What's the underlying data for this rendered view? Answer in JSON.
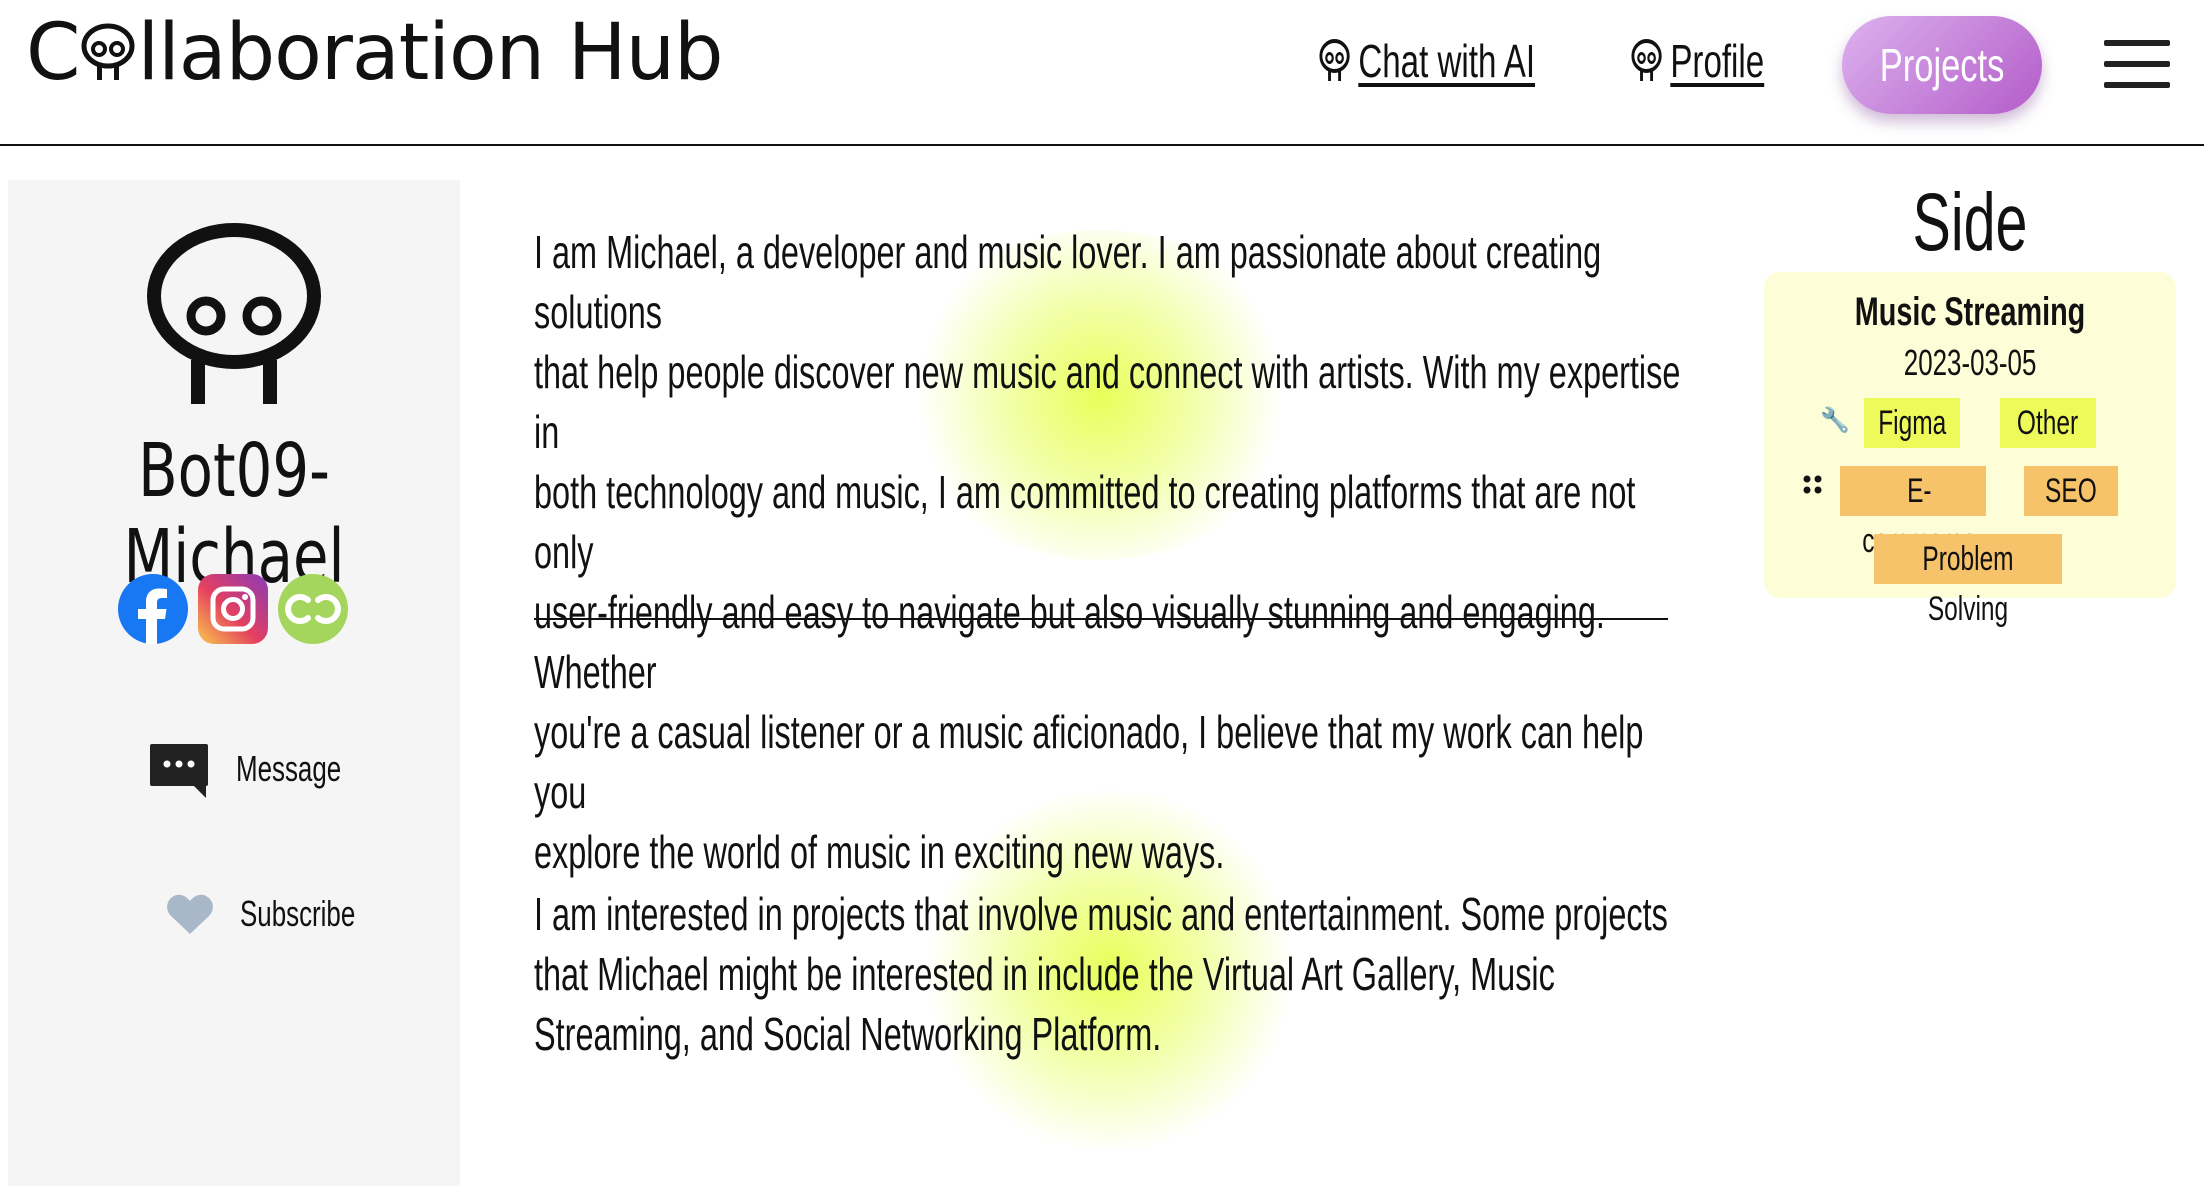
{
  "header": {
    "brand": {
      "prefix": "C",
      "suffix": "llaboration Hub"
    },
    "nav": [
      {
        "label": "Chat with AI",
        "icon": "bot-icon"
      },
      {
        "label": "Profile",
        "icon": "bot-icon"
      }
    ],
    "projects_button": "Projects",
    "menu_icon": "hamburger-menu-icon"
  },
  "sidebar": {
    "name": "Bot09-Michael",
    "socials": [
      "facebook-icon",
      "instagram-icon",
      "chain-link-icon"
    ],
    "message_label": "Message",
    "subscribe_label": "Subscribe"
  },
  "main": {
    "bio_lines": [
      "I am Michael, a developer and music lover. I am passionate about creating solutions",
      "that help people discover new music and connect with artists. With my expertise in",
      "both technology and music, I am committed to creating platforms that are not only",
      "user-friendly and easy to navigate but also visually stunning and engaging. Whether",
      "you're a casual listener or a music aficionado, I believe that my work can help you",
      "explore the world of music in exciting new ways."
    ],
    "interest_lines": [
      "I am interested in projects that involve music and entertainment. Some projects",
      "that Michael might be interested in include the Virtual Art Gallery, Music",
      "Streaming, and Social Networking Platform."
    ]
  },
  "side_projects": {
    "title": "Side projects",
    "card": {
      "name": "Music Streaming",
      "date": "2023-03-05",
      "tools": [
        "Figma",
        "Other"
      ],
      "skills": [
        "E-commerce",
        "SEO",
        "Problem Solving"
      ]
    }
  },
  "colors": {
    "projects_button_start": "#dcb2ee",
    "projects_button_end": "#b45cc9",
    "tool_tag": "#eefa5a",
    "skill_tag": "#f6c26a",
    "card_bg": "#fdfdd8",
    "sidebar_bg": "#f5f5f5"
  }
}
